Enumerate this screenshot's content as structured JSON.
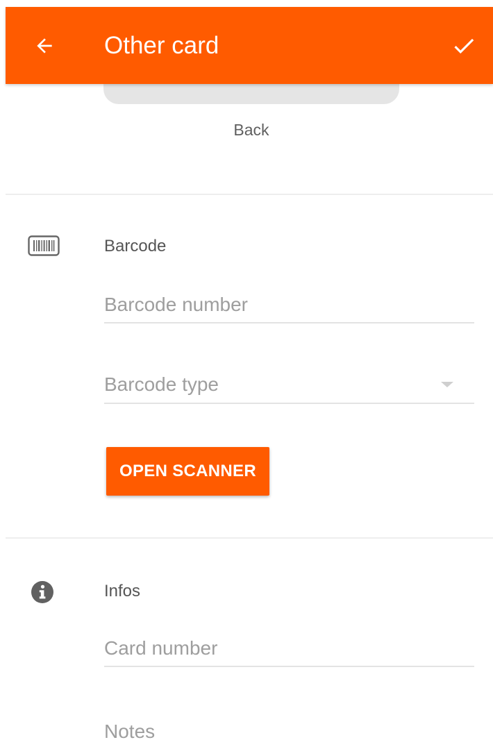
{
  "app_bar": {
    "title": "Other card",
    "back_icon": "arrow-back-icon",
    "save_icon": "check-icon",
    "color": "#ff5b00"
  },
  "card_preview": {
    "back_label": "Back"
  },
  "barcode_section": {
    "icon": "barcode-icon",
    "title": "Barcode",
    "barcode_number_placeholder": "Barcode number",
    "barcode_type_placeholder": "Barcode type",
    "open_scanner_label": "OPEN SCANNER"
  },
  "infos_section": {
    "icon": "info-icon",
    "title": "Infos",
    "card_number_placeholder": "Card number",
    "notes_placeholder": "Notes"
  }
}
